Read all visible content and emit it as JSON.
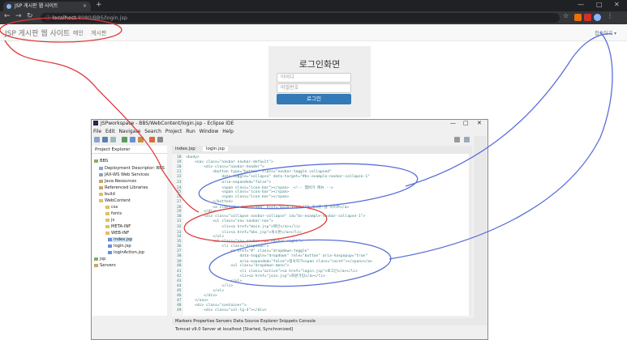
{
  "browser": {
    "tab_title": "JSP 게시판 웹 사이트",
    "tab_close": "×",
    "new_tab": "+",
    "url_host": "localhost",
    "url_path": ":8080/BBS/login.jsp",
    "window_controls": [
      "—",
      "□",
      "✕"
    ]
  },
  "site": {
    "brand": "JSP 게시판 웹 사이트",
    "nav": [
      "메인",
      "게시판"
    ],
    "dropdown": "접속하기 ▾"
  },
  "login": {
    "title": "로그인화면",
    "id_placeholder": "아이디",
    "pw_placeholder": "비밀번호",
    "button": "로그인"
  },
  "eclipse": {
    "title": "JSPworkspace - BBS/WebContent/login.jsp - Eclipse IDE",
    "menu": "File  Edit  Navigate  Search  Project  Run  Window  Help",
    "project_explorer": "Project Explorer",
    "tree": [
      "BBS",
      "Deployment Descriptor: BBS",
      "JAX-WS Web Services",
      "Java Resources",
      "Referenced Libraries",
      "build",
      "WebContent",
      "css",
      "fonts",
      "js",
      "META-INF",
      "WEB-INF",
      "index.jsp",
      "login.jsp",
      "loginAction.jsp",
      "jsp",
      "Servers"
    ],
    "editor_tabs": [
      "index.jsp",
      "login.jsp"
    ],
    "code": [
      "18⁠  <body>",
      "19⁠      <nav class=\"navbar navbar-default\">",
      "20⁠          <div class=\"navbar-header\">",
      "21⁠              <button type=\"button\" class=\"navbar-toggle collapsed\"",
      "22⁠                  data-toggle=\"collapse\" data-target=\"#bs-example-navbar-collapse-1\"",
      "23⁠                  aria-expanded=\"false\">",
      "24⁠                  <span class=\"icon-bar\"></span>  <!-- 햄버거 메뉴 -->",
      "25⁠                  <span class=\"icon-bar\"></span>",
      "26⁠                  <span class=\"icon-bar\"></span>",
      "27⁠              </button>",
      "28⁠              <a class=\"navbar-brand\" href=\"main.jsp\">JSP 게시판 웹 사이트</a>",
      "29⁠          </div>",
      "30⁠          <div class=\"collapse navbar-collapse\" id=\"bs-example-navbar-collapse-1\">",
      "31⁠              <ul class=\"nav navbar-nav\">",
      "32⁠                  <li><a href=\"main.jsp\">메인</a></li>",
      "33⁠                  <li><a href=\"bbs.jsp\">게시판</a></li>",
      "34⁠              </ul>",
      "35⁠              <ul class=\"nav navbar-nav navbar-right\">",
      "36⁠                  <li class=\"dropdown\">",
      "37⁠                      <a href=\"#\" class=\"dropdown-toggle\"",
      "38⁠                          data-toggle=\"dropdown\" role=\"button\" aria-haspopup=\"true\"",
      "39⁠                          aria-expanded=\"false\">접속하기<span class=\"caret\"></span></a>",
      "40⁠                      <ul class=\"dropdown-menu\">",
      "41⁠                          <li class=\"active\"><a href=\"login.jsp\">로그인</a></li>",
      "42⁠                          <li><a href=\"join.jsp\">회원가입</a></li>",
      "43⁠                      </ul>",
      "44⁠                  </li>",
      "45⁠              </ul>",
      "46⁠          </div>",
      "47⁠      </nav>",
      "48⁠      <div class=\"container\">",
      "49⁠          <div class=\"col-lg-4\"></div>"
    ],
    "bottom_tabs": "Markers  Properties  Servers  Data Source Explorer  Snippets  Console",
    "server_status": "Tomcat v9.0 Server at localhost  [Started, Synchronized]"
  },
  "colors": {
    "annotation_red": "#e03a3a",
    "annotation_blue": "#5a6fd8",
    "bootstrap_primary": "#337ab7"
  }
}
